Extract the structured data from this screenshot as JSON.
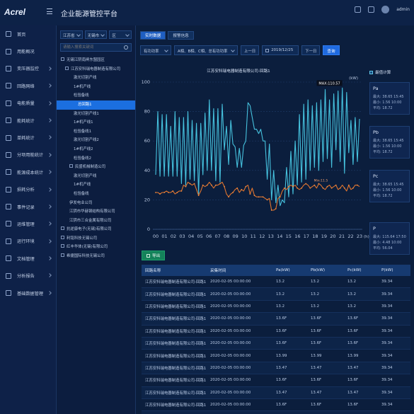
{
  "header": {
    "logo": "Acrel",
    "title": "企业能源管控平台",
    "user": "admin"
  },
  "sidebar": {
    "items": [
      {
        "label": "首页",
        "icon": "home-icon"
      },
      {
        "label": "用能概况",
        "icon": "overview-icon"
      },
      {
        "label": "变压器监控",
        "icon": "transformer-icon"
      },
      {
        "label": "回路网络",
        "icon": "network-icon"
      },
      {
        "label": "电能质量",
        "icon": "quality-icon"
      },
      {
        "label": "能耗统计",
        "icon": "stats-icon"
      },
      {
        "label": "单耗统计",
        "icon": "unit-icon"
      },
      {
        "label": "分项用能统计",
        "icon": "itemize-icon"
      },
      {
        "label": "能源成本统计",
        "icon": "cost-icon"
      },
      {
        "label": "损耗分析",
        "icon": "loss-icon"
      },
      {
        "label": "事件记录",
        "icon": "event-icon"
      },
      {
        "label": "运维管理",
        "icon": "maintenance-icon"
      },
      {
        "label": "运行环境",
        "icon": "environment-icon"
      },
      {
        "label": "文档管理",
        "icon": "document-icon"
      },
      {
        "label": "分析报告",
        "icon": "report-icon"
      },
      {
        "label": "基础数据管理",
        "icon": "data-icon"
      }
    ]
  },
  "tree": {
    "selects": [
      "江苏省",
      "无锡市",
      "区"
    ],
    "search_placeholder": "请输入搜索关键词",
    "items": [
      {
        "label": "无锡江阴南闸东盟园区",
        "level": 0,
        "toggle": true
      },
      {
        "label": "江苏安科瑞电器制造有限公司",
        "level": 1,
        "toggle": true
      },
      {
        "label": "激光切割产线",
        "level": 3
      },
      {
        "label": "1#机产线",
        "level": 3
      },
      {
        "label": "检验备线",
        "level": 3
      },
      {
        "label": "总回路1",
        "level": 4,
        "selected": true
      },
      {
        "label": "激光切割产线1",
        "level": 3
      },
      {
        "label": "1#机产线1",
        "level": 3
      },
      {
        "label": "检验备线1",
        "level": 3
      },
      {
        "label": "激光切割产线2",
        "level": 3
      },
      {
        "label": "1#机产线2",
        "level": 3
      },
      {
        "label": "检验备线2",
        "level": 3
      },
      {
        "label": "民盛机械制造公司",
        "level": 2,
        "toggle": true
      },
      {
        "label": "激光切割产线",
        "level": 3
      },
      {
        "label": "1#机产线",
        "level": 3
      },
      {
        "label": "检验备线",
        "level": 3
      },
      {
        "label": "伊发电业公司",
        "level": 2
      },
      {
        "label": "江阴市华赫钢结构有限公司",
        "level": 2
      },
      {
        "label": "江阴市三合金属有限公司",
        "level": 2
      },
      {
        "label": "抗逆康电子(无锡)有限公司",
        "level": 0,
        "toggle": true
      },
      {
        "label": "利铭科技无锡公司",
        "level": 0,
        "toggle": true
      },
      {
        "label": "红丰华体(无锡)有限公司",
        "level": 0,
        "toggle": true
      },
      {
        "label": "希捷国际科技无锡公司",
        "level": 0,
        "toggle": true
      }
    ]
  },
  "main": {
    "tabs": [
      "实时数据",
      "报警信息"
    ],
    "filter": {
      "metric": "有功功率",
      "phases": "A相、B相、C相、总有功功率",
      "prev": "上一日",
      "date": "2019/12/25",
      "next": "下一日",
      "query": "查询"
    },
    "export": "导出",
    "legend_max": "最值计算"
  },
  "chart_data": {
    "type": "line",
    "title": "江苏安科瑞电器制造有限公司-回路1",
    "ylabel": "(kW)",
    "xlabel": "(h)",
    "x_ticks": [
      "00",
      "01",
      "02",
      "03",
      "04",
      "05",
      "06",
      "07",
      "08",
      "09",
      "10",
      "11",
      "12",
      "13",
      "14",
      "15",
      "16",
      "17",
      "18",
      "19",
      "20",
      "21",
      "22",
      "23"
    ],
    "y_ticks": [
      0,
      20,
      40,
      60,
      80,
      100
    ],
    "ylim": [
      0,
      100
    ],
    "annotations": {
      "max_label": "MAX:110.57",
      "min_label": "Min:11.5"
    },
    "series": [
      {
        "name": "P",
        "color": "#46c2de",
        "values": [
          37,
          80,
          36,
          78,
          36,
          78,
          36,
          70,
          36,
          80,
          36,
          76,
          31,
          76,
          30,
          80,
          34,
          74,
          33,
          72,
          24,
          72,
          37,
          79,
          40,
          88,
          40,
          82,
          33,
          82,
          32,
          85,
          54,
          70,
          44,
          74,
          58,
          56,
          42,
          55,
          42,
          57,
          60,
          86,
          84,
          76,
          68,
          68,
          65,
          68,
          60,
          60,
          34,
          58,
          20,
          40,
          18,
          30,
          16,
          20,
          18,
          42,
          22,
          53,
          24,
          60,
          30,
          78,
          32,
          85,
          34,
          88,
          40,
          84,
          42,
          86,
          40,
          88,
          46,
          95,
          48,
          88,
          42,
          92,
          54,
          94,
          46,
          96,
          38,
          93,
          52,
          74,
          44,
          76,
          46,
          75
        ]
      },
      {
        "name": "Pa",
        "color": "#e0742e",
        "values": [
          25,
          25,
          24,
          25,
          25,
          26,
          25,
          25,
          26,
          24,
          25,
          26,
          26,
          30,
          29,
          32,
          31,
          30,
          31,
          27,
          23,
          26,
          30,
          29,
          30,
          32,
          30,
          28,
          30,
          30,
          31,
          32,
          29,
          24,
          22,
          24,
          25,
          27,
          28,
          25,
          27,
          26,
          29,
          30,
          24,
          28,
          23,
          22,
          22,
          22,
          22,
          21,
          20,
          21,
          13,
          13,
          14,
          21,
          22,
          26,
          28,
          27,
          29,
          30,
          29,
          30,
          28,
          27,
          28,
          30,
          31,
          30,
          28,
          29,
          30,
          28,
          31,
          30,
          28,
          27,
          29,
          30,
          28,
          29,
          30,
          27,
          28,
          30,
          28,
          26,
          30,
          27,
          28,
          30,
          30,
          29
        ]
      }
    ]
  },
  "side_cards": [
    {
      "title": "Pa",
      "lines": [
        "最大: 38.65  15:45",
        "最小: 1.56  10:00",
        "平均: 18.72"
      ]
    },
    {
      "title": "Pb",
      "lines": [
        "最大: 38.65  15:45",
        "最小: 1.56  10:00",
        "平均: 18.72"
      ]
    },
    {
      "title": "Pc",
      "lines": [
        "最大: 38.65  15:45",
        "最小: 1.56  10:00",
        "平均: 18.72"
      ]
    },
    {
      "title": "P",
      "lines": [
        "最大: 115.64  17:50",
        "最小: 4.48  10:00",
        "平均: 56.04"
      ]
    }
  ],
  "table": {
    "headers": [
      "回路名称",
      "采集时间",
      "Pa(kW)",
      "Pb(kW)",
      "Pc(kW)",
      "P(kW)"
    ],
    "rows": [
      [
        "江苏安科瑞电器制造有限公司-回路1",
        "2020-02-05 00:00:00",
        "13.2",
        "13.2",
        "13.2",
        "39.34"
      ],
      [
        "江苏安科瑞电器制造有限公司-回路1",
        "2020-02-05 00:00:00",
        "13.2",
        "13.2",
        "13.2",
        "39.34"
      ],
      [
        "江苏安科瑞电器制造有限公司-回路1",
        "2020-02-05 00:00:00",
        "13.2",
        "13.2",
        "13.2",
        "39.34"
      ],
      [
        "江苏安科瑞电器制造有限公司-回路1",
        "2020-02-05 00:00:00",
        "13.6F",
        "13.6F",
        "13.6F",
        "39.34"
      ],
      [
        "江苏安科瑞电器制造有限公司-回路1",
        "2020-02-05 00:00:00",
        "13.6F",
        "13.6F",
        "13.6F",
        "39.34"
      ],
      [
        "江苏安科瑞电器制造有限公司-回路1",
        "2020-02-05 00:00:00",
        "13.6F",
        "13.6F",
        "13.6F",
        "39.34"
      ],
      [
        "江苏安科瑞电器制造有限公司-回路1",
        "2020-02-05 00:00:00",
        "13.99",
        "13.99",
        "13.99",
        "39.34"
      ],
      [
        "江苏安科瑞电器制造有限公司-回路1",
        "2020-02-05 00:00:00",
        "13.47",
        "13.47",
        "13.47",
        "39.34"
      ],
      [
        "江苏安科瑞电器制造有限公司-回路1",
        "2020-02-05 00:00:00",
        "13.6F",
        "13.6F",
        "13.6F",
        "39.34"
      ],
      [
        "江苏安科瑞电器制造有限公司-回路1",
        "2020-02-05 00:00:00",
        "13.47",
        "13.47",
        "13.47",
        "39.34"
      ],
      [
        "江苏安科瑞电器制造有限公司-回路1",
        "2020-02-05 00:00:00",
        "13.6F",
        "13.6F",
        "13.6F",
        "39.34"
      ],
      [
        "江苏安科瑞电器制造有限公司-回路1",
        "2020-02-05 00:00:00",
        "13.47",
        "13.47",
        "13.47",
        "39.34"
      ]
    ]
  }
}
